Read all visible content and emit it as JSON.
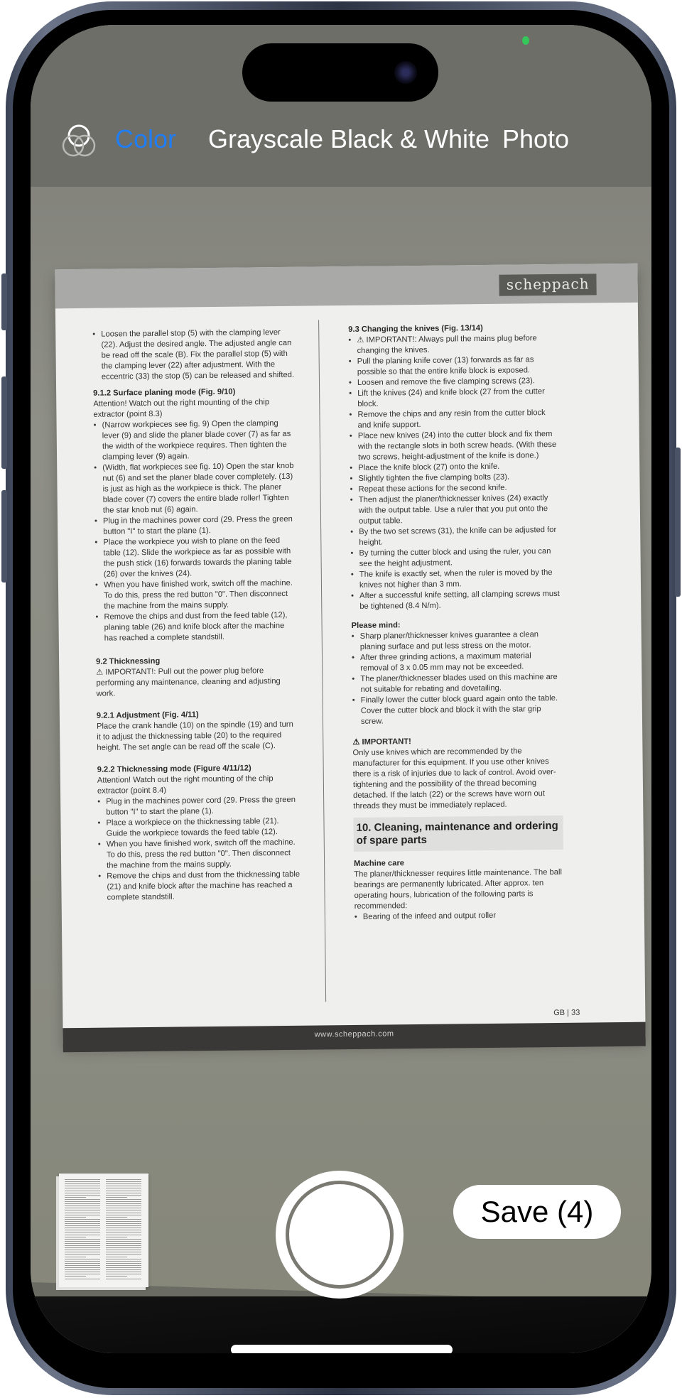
{
  "app": "Document Scanner Camera",
  "filters": {
    "items": [
      {
        "label": "Color",
        "active": true
      },
      {
        "label": "Grayscale",
        "active": false
      },
      {
        "label": "Black & White",
        "active": false
      },
      {
        "label": "Photo",
        "active": false
      }
    ],
    "icon": "filters-icon",
    "accent": "#1f7ef5"
  },
  "document": {
    "brand": "scheppach",
    "footer_url": "www.scheppach.com",
    "page_number": "GB | 33",
    "left_column": {
      "intro_bullet": "Loosen the parallel stop (5) with the clamping lever (22). Adjust the desired angle. The adjusted angle can be read off the scale (B). Fix the parallel stop (5) with the clamping lever (22) after adjustment. With the eccentric (33) the stop (5) can be released and shifted.",
      "s912_title": "9.1.2 Surface planing mode (Fig. 9/10)",
      "s912_attention": "Attention! Watch out the right mounting of the chip extractor (point 8.3)",
      "s912_bullets": [
        "(Narrow workpieces see fig. 9) Open the clamping lever (9) and slide the planer blade cover (7) as far as the width of the workpiece requires. Then tighten the clamping lever (9) again.",
        "(Width, flat workpieces see fig. 10) Open the star knob nut (6) and set the planer blade cover completely. (13) is just as high as the workpiece is thick. The planer blade cover (7) covers the entire blade roller! Tighten the star knob nut (6) again.",
        "Plug in the machines power cord (29. Press the green button \"I\" to start the plane (1).",
        "Place the workpiece you wish to plane on the feed table (12). Slide the workpiece as far as possible with the push stick (16) forwards towards the planing table (26) over the knives (24).",
        "When you have finished work, switch off the machine. To do this, press the red button \"0\". Then disconnect the machine from the mains supply.",
        "Remove the chips and dust from the feed table (12), planing table (26) and knife block after the machine has reached a complete standstill."
      ],
      "s92_title": "9.2 Thicknessing",
      "s92_important": "⚠ IMPORTANT!: Pull out the power plug before performing any maintenance, cleaning and adjusting work.",
      "s921_title": "9.2.1 Adjustment (Fig. 4/11)",
      "s921_text": "Place the crank handle (10) on the spindle (19) and turn it to adjust the thicknessing table (20) to the required height. The set angle can be read off the scale (C).",
      "s922_title": "9.2.2 Thicknessing mode (Figure 4/11/12)",
      "s922_attention": "Attention! Watch out the right mounting of the chip extractor (point 8.4)",
      "s922_bullets": [
        "Plug in the machines power cord (29. Press the green button \"I\" to start the plane (1).",
        "Place a workpiece on the thicknessing table (21). Guide the workpiece towards the feed table (12).",
        "When you have finished work, switch off the machine. To do this, press the red button \"0\". Then disconnect the machine from the mains supply.",
        "Remove the chips and dust from the thicknessing table (21) and knife block after the machine has reached a complete standstill."
      ]
    },
    "right_column": {
      "s93_title": "9.3 Changing the knives (Fig. 13/14)",
      "s93_bullets": [
        "⚠ IMPORTANT!: Always pull the mains plug before changing the knives.",
        "Pull the planing knife cover (13) forwards as far as possible so that the entire knife block is exposed.",
        "Loosen and remove the five clamping screws (23).",
        "Lift the knives (24) and knife block (27 from the cutter block.",
        "Remove the chips and any resin from the cutter block and knife support.",
        "Place new knives (24) into the cutter block and fix them with the rectangle slots in both screw heads. (With these two screws, height-adjustment of the knife is done.)",
        "Place the knife block (27) onto the knife.",
        "Slightly tighten the five clamping bolts (23).",
        "Repeat these actions for the second knife.",
        "Then adjust the planer/thicknesser knives (24) exactly with the output table. Use a ruler that you put onto the output table.",
        "By the two set screws (31), the knife can be adjusted for height.",
        "By turning the cutter block and using the ruler, you can see the height adjustment.",
        "The knife is exactly set, when the ruler is moved by the knives not higher than 3 mm.",
        "After a successful knife setting, all clamping screws must be tightened (8.4 N/m)."
      ],
      "mind_title": "Please mind:",
      "mind_bullets": [
        "Sharp planer/thicknesser knives guarantee a clean planing surface and put less stress on the motor.",
        "After three grinding actions, a maximum material removal of 3 x 0.05 mm may not be exceeded.",
        "The planer/thicknesser blades used on this machine are not suitable for rebating and dovetailing.",
        "Finally lower the cutter block guard again onto the table. Cover the cutter block and block it with the star grip screw."
      ],
      "important_title": "⚠ IMPORTANT!",
      "important_text": "Only use knives which are recommended by the manufacturer for this equipment. If you use other knives there is a risk of injuries due to lack of control. Avoid over-tightening and the possibility of the thread becoming detached. If the latch (22) or the screws have worn out threads they must be immediately replaced.",
      "s10_title": "10. Cleaning, maintenance and ordering of spare parts",
      "care_title": "Machine care",
      "care_text": "The planer/thicknesser requires little maintenance. The ball bearings are permanently lubricated. After approx. ten operating hours, lubrication of the following parts is recommended:",
      "care_bullets": [
        "Bearing of the infeed and output roller"
      ]
    }
  },
  "controls": {
    "thumbnail": "scanned-page-thumbnail",
    "shutter": "shutter-button",
    "save_label": "Save (4)"
  }
}
